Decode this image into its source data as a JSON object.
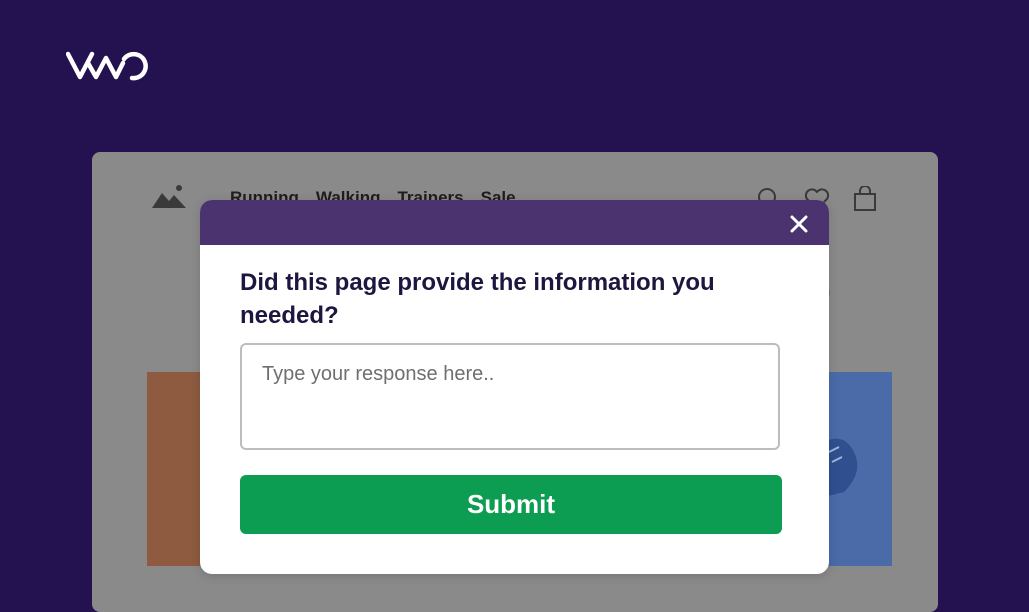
{
  "brand": {
    "logo_text": "VWO",
    "logo_icon": "vwo-logo"
  },
  "website": {
    "logo_icon": "image-placeholder-icon",
    "nav_items": [
      "Running",
      "Walking",
      "Trainers",
      "Sale"
    ],
    "icons": [
      "search-icon",
      "heart-icon",
      "shopping-bag-icon"
    ],
    "heading_fragment": "r"
  },
  "modal": {
    "question": "Did this page provide the information you needed?",
    "response_placeholder": "Type your response here..",
    "submit_label": "Submit",
    "close_icon": "close-icon"
  },
  "colors": {
    "background": "#241150",
    "modal_header": "#4a336e",
    "submit_button": "#0c9c52",
    "question_text": "#1f1640"
  }
}
